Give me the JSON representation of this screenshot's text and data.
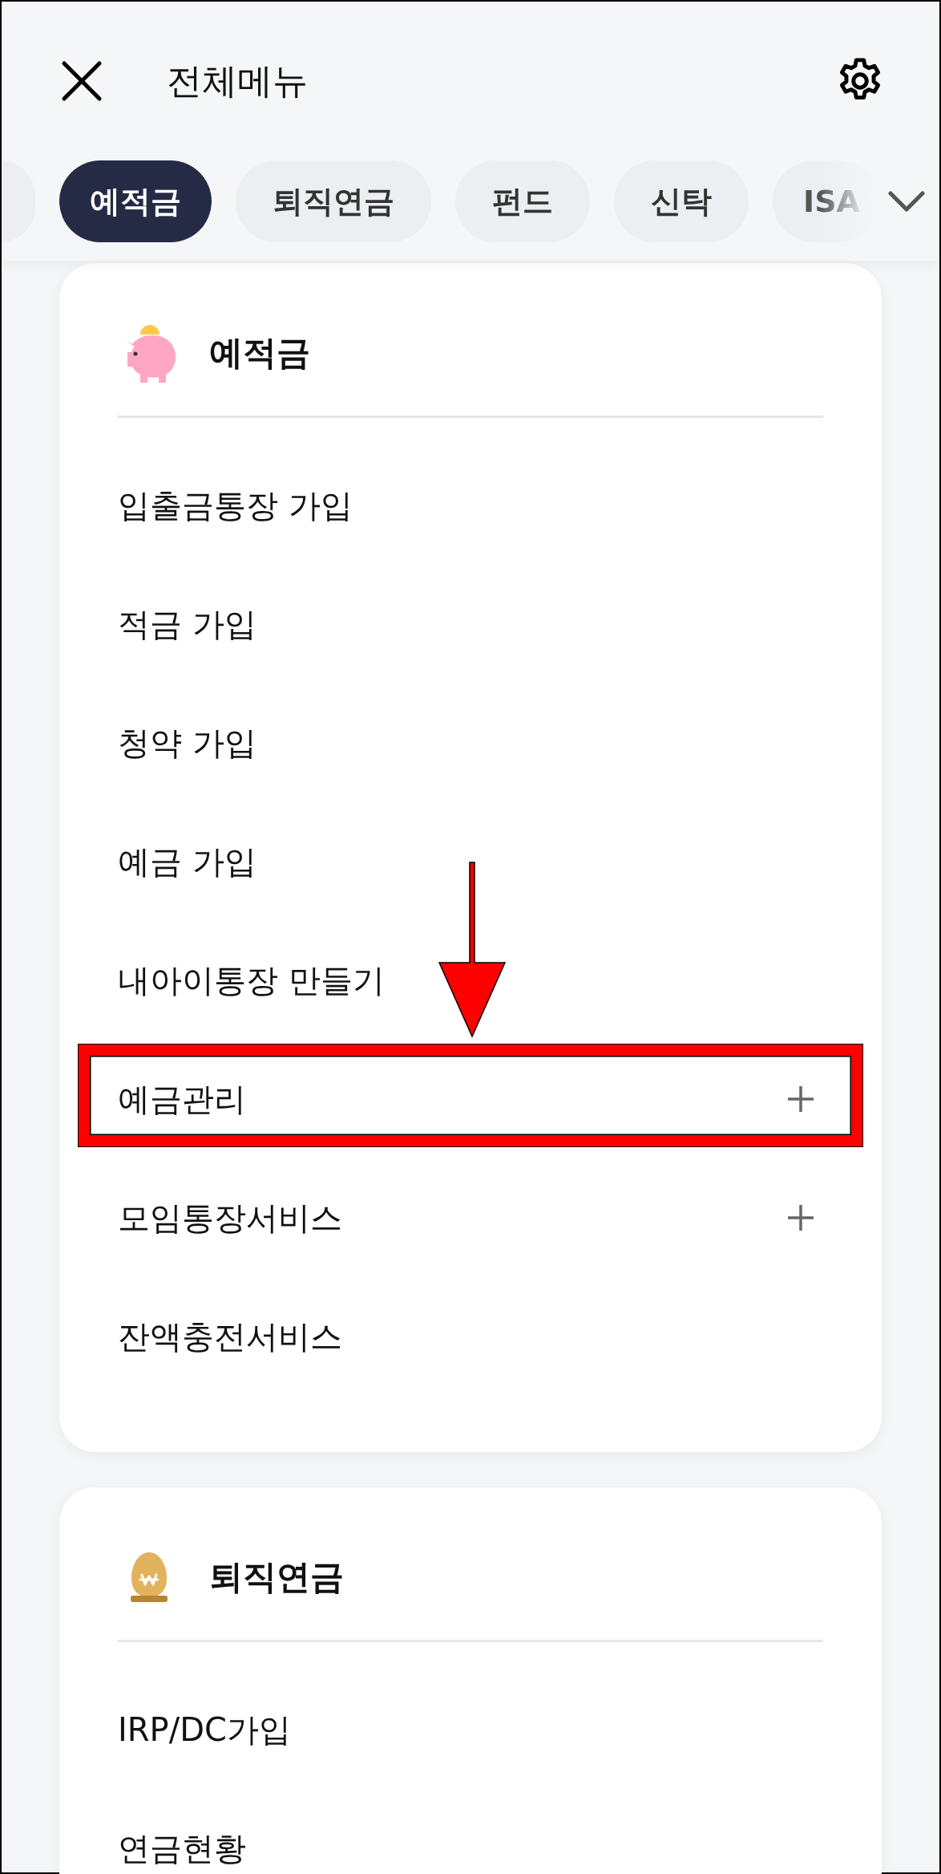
{
  "header": {
    "title": "전체메뉴"
  },
  "tabs": [
    {
      "label": "예적금",
      "selected": true
    },
    {
      "label": "퇴직연금",
      "selected": false
    },
    {
      "label": "펀드",
      "selected": false
    },
    {
      "label": "신탁",
      "selected": false
    },
    {
      "label": "ISA",
      "selected": false
    }
  ],
  "sections": [
    {
      "title": "예적금",
      "items": [
        {
          "label": "입출금통장 가입",
          "expandable": false,
          "highlighted": false
        },
        {
          "label": "적금 가입",
          "expandable": false,
          "highlighted": false
        },
        {
          "label": "청약 가입",
          "expandable": false,
          "highlighted": false
        },
        {
          "label": "예금 가입",
          "expandable": false,
          "highlighted": false
        },
        {
          "label": "내아이통장 만들기",
          "expandable": false,
          "highlighted": false
        },
        {
          "label": "예금관리",
          "expandable": true,
          "highlighted": true
        },
        {
          "label": "모임통장서비스",
          "expandable": true,
          "highlighted": false
        },
        {
          "label": "잔액충전서비스",
          "expandable": false,
          "highlighted": false
        }
      ]
    },
    {
      "title": "퇴직연금",
      "items": [
        {
          "label": "IRP/DC가입",
          "expandable": false,
          "highlighted": false
        },
        {
          "label": "연금현황",
          "expandable": false,
          "highlighted": false
        }
      ]
    }
  ]
}
